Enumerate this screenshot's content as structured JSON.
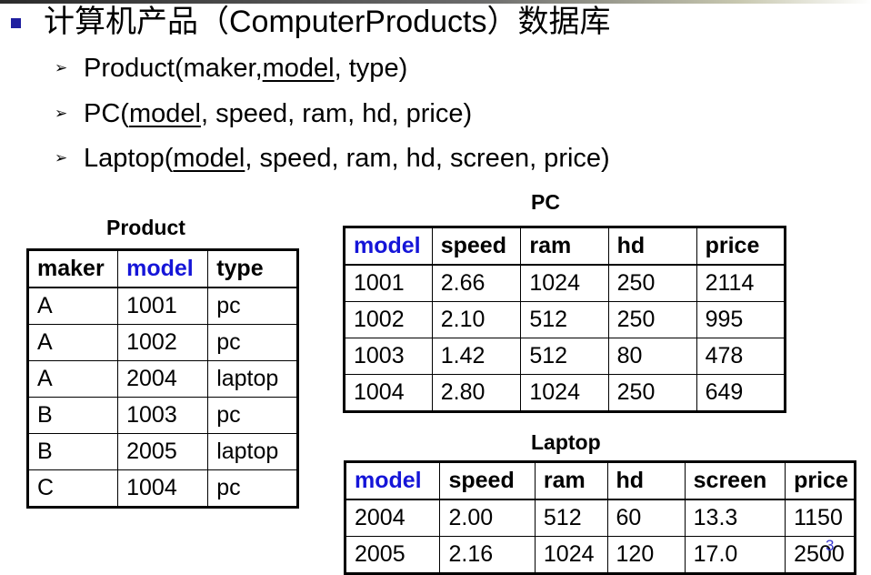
{
  "title": "计算机产品（ComputerProducts）数据库",
  "schemas": [
    {
      "name": "Product(",
      "key": "maker,model",
      "rest": ", type)",
      "key_prefix": "maker,",
      "key_attr": "model"
    },
    {
      "name": "PC(",
      "key": "model",
      "rest": ", speed, ram, hd, price)"
    },
    {
      "name": "Laptop(",
      "key": "model",
      "rest": ", speed, ram, hd, screen, price)"
    }
  ],
  "product_table": {
    "caption": "Product",
    "columns": [
      "maker",
      "model",
      "type"
    ],
    "rows": [
      [
        "A",
        "1001",
        "pc"
      ],
      [
        "A",
        "1002",
        "pc"
      ],
      [
        "A",
        "2004",
        "laptop"
      ],
      [
        "B",
        "1003",
        "pc"
      ],
      [
        "B",
        "2005",
        "laptop"
      ],
      [
        "C",
        "1004",
        "pc"
      ]
    ]
  },
  "pc_table": {
    "caption": "PC",
    "columns": [
      "model",
      "speed",
      "ram",
      "hd",
      "price"
    ],
    "rows": [
      [
        "1001",
        "2.66",
        "1024",
        "250",
        "2114"
      ],
      [
        "1002",
        "2.10",
        "512",
        "250",
        "995"
      ],
      [
        "1003",
        "1.42",
        "512",
        "80",
        "478"
      ],
      [
        "1004",
        "2.80",
        "1024",
        "250",
        "649"
      ]
    ]
  },
  "laptop_table": {
    "caption": "Laptop",
    "columns": [
      "model",
      "speed",
      "ram",
      "hd",
      "screen",
      "price"
    ],
    "rows": [
      [
        "2004",
        "2.00",
        "512",
        "60",
        "13.3",
        "1150"
      ],
      [
        "2005",
        "2.16",
        "1024",
        "120",
        "17.0",
        "2500"
      ]
    ]
  },
  "page_number": "3",
  "colors": {
    "bullet": "#1f1fa0",
    "key_column": "#1515d8",
    "page_number": "#3a3ad0"
  }
}
